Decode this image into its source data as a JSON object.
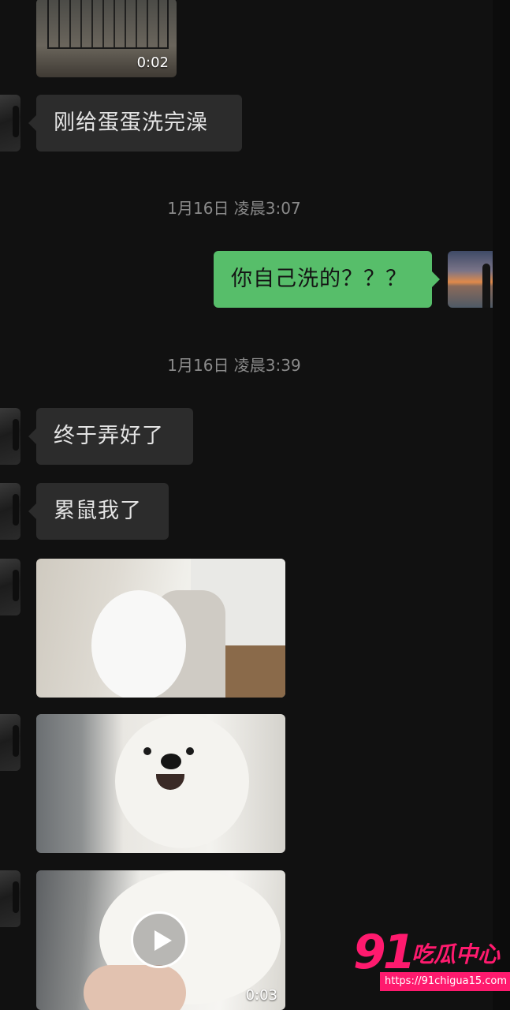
{
  "conversation": {
    "messages": [
      {
        "type": "video",
        "direction": "in",
        "duration": "0:02"
      },
      {
        "type": "text",
        "direction": "in",
        "text": "刚给蛋蛋洗完澡"
      },
      {
        "type": "timestamp",
        "text": "1月16日 凌晨3:07"
      },
      {
        "type": "text",
        "direction": "out",
        "text": "你自己洗的？？？"
      },
      {
        "type": "timestamp",
        "text": "1月16日 凌晨3:39"
      },
      {
        "type": "text",
        "direction": "in",
        "text": "终于弄好了"
      },
      {
        "type": "text",
        "direction": "in",
        "text": "累鼠我了"
      },
      {
        "type": "image",
        "direction": "in"
      },
      {
        "type": "image",
        "direction": "in"
      },
      {
        "type": "video",
        "direction": "in",
        "duration": "0:03"
      }
    ]
  },
  "watermark": {
    "number": "91",
    "name": "吃瓜中心",
    "url": "https://91chigua15.com"
  },
  "colors": {
    "background": "#111111",
    "incoming_bubble": "#2c2c2c",
    "outgoing_bubble": "#57be6a",
    "timestamp_text": "#8b8b8b",
    "watermark": "#ff1a6e"
  },
  "icons": [
    "play-icon"
  ]
}
